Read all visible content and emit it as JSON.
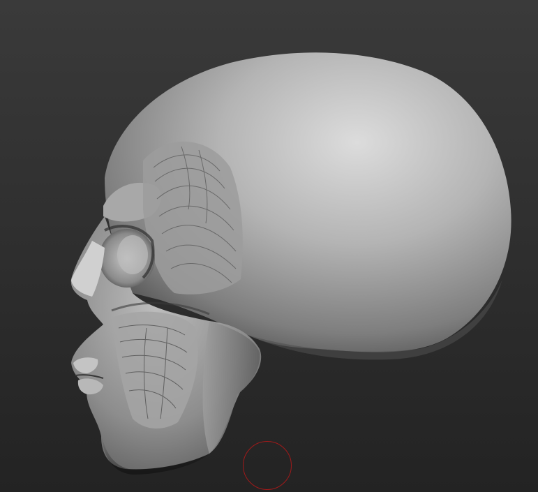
{
  "canvas": {
    "background_top": "#3a3a3a",
    "background_bottom": "#232323"
  },
  "model": {
    "material_light": "#d6d6d6",
    "material_mid": "#9a9a9a",
    "material_dark": "#4a4a4a"
  },
  "brush": {
    "cursor_color": "#a11a1a"
  }
}
